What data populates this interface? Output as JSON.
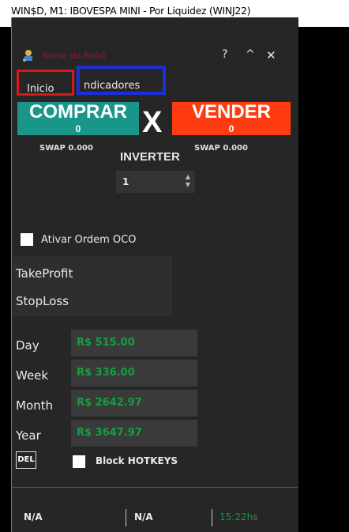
{
  "chart": {
    "title": "WIN$D, M1:  IBOVESPA MINI - Por Liquidez (WINJ22)"
  },
  "panel": {
    "app_name": "Nome do Robô",
    "controls": {
      "help": "?",
      "minimize": "^",
      "close": "✕"
    },
    "tabs": [
      {
        "label": "Inicio"
      },
      {
        "label": "ndicadores"
      }
    ],
    "buy": {
      "label": "COMPRAR",
      "count": "0",
      "swap": "SWAP 0.000"
    },
    "sell": {
      "label": "VENDER",
      "count": "0",
      "swap": "SWAP 0.000"
    },
    "separator": "X",
    "inverter": {
      "label": "INVERTER",
      "value": "1"
    },
    "oco": {
      "label": "Ativar Ordem OCO",
      "checked": false
    },
    "take_profit": {
      "label": "TakeProfit"
    },
    "stop_loss": {
      "label": "StopLoss"
    },
    "profits": [
      {
        "label": "Day",
        "value": "R$ 515.00"
      },
      {
        "label": "Week",
        "value": "R$ 336.00"
      },
      {
        "label": "Month",
        "value": "R$ 2642.97"
      },
      {
        "label": "Year",
        "value": "R$ 3647.97"
      }
    ],
    "del_label": "DEL",
    "block_hotkeys": {
      "label": "Block HOTKEYS",
      "checked": false
    },
    "status": {
      "left": "N/A",
      "middle": "N/A",
      "clock": "15:22hs"
    }
  },
  "colors": {
    "buy": "#1a958a",
    "sell": "#ff3b12",
    "profit_text": "#16a040"
  }
}
